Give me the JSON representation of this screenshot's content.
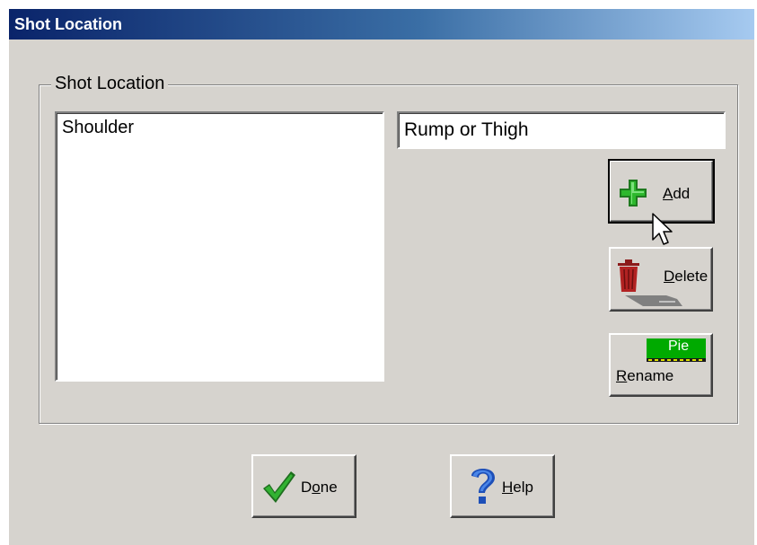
{
  "window": {
    "title": "Shot Location"
  },
  "group": {
    "label": "Shot Location"
  },
  "list": {
    "items": [
      "Shoulder"
    ]
  },
  "name_field": {
    "value": "Rump or Thigh"
  },
  "buttons": {
    "add": {
      "accel": "A",
      "rest": "dd"
    },
    "delete": {
      "accel": "D",
      "rest": "elete"
    },
    "rename": {
      "badge": "Pie",
      "accel": "R",
      "rest": "ename"
    },
    "done": {
      "pre": "D",
      "accel": "o",
      "rest": "ne"
    },
    "help": {
      "accel": "H",
      "rest": "elp"
    }
  },
  "icons": {
    "add": "plus-icon",
    "delete": "trash-can-icon",
    "rename": "rename-icon",
    "done": "checkmark-icon",
    "help": "question-mark-icon",
    "cursor": "mouse-cursor-icon"
  },
  "colors": {
    "titlebar_start": "#0a246a",
    "titlebar_end": "#a6caf0",
    "dialog_bg": "#d6d3ce"
  }
}
